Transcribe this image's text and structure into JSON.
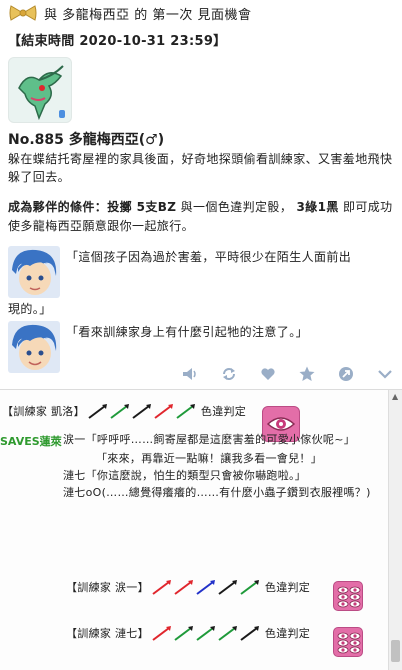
{
  "post": {
    "title": "與 多龍梅西亞 的 第一次 見面機會",
    "end_time": "【結束時間 2020-10-31 23:59】",
    "pokemon_name": "No.885 多龍梅西亞(♂)",
    "description": "躲在蝶結托寄屋裡的家具後面，好奇地探頭偷看訓練家、又害羞地飛快躲了回去。",
    "condition_prefix": "成為夥伴的條件：投擲 ",
    "condition_bz": "5支BZ",
    "condition_mid": " 與一個色違判定骰， ",
    "condition_result": "3綠1黑",
    "condition_suffix": " 即可成功使多龍梅西亞願意跟你一起旅行。",
    "dialog1": "「這個孩子因為過於害羞，平時很少在陌生人面前出",
    "dialog1_cont": "現的。」",
    "dialog2": "「看來訓練家身上有什麼引起牠的注意了。」"
  },
  "toolbar": {
    "icons": [
      "volume-icon",
      "repost-icon",
      "heart-icon",
      "star-icon",
      "share-icon",
      "chevron-down-icon"
    ]
  },
  "rolls": {
    "roll1_label": "【訓練家 凱洛】",
    "roll1_verdict": "色違判定",
    "roll2_label": "【訓練家 涙一】",
    "roll2_verdict": "色違判定",
    "roll3_label": "【訓練家 漣七】",
    "roll3_verdict": "色違判定"
  },
  "comment": {
    "user": "SAVES蓮萊",
    "line1": "涙一「呼呼呼……飼寄屋都是這麼害羞的可愛小傢伙呢~」",
    "line2": "「來來，再靠近一點嘛！讓我多看一會兒！」",
    "line3": "漣七「你這麼說，怕生的類型只會被你嚇跑啦。」",
    "line4": "漣七oO(……總覺得癢癢的……有什麼小蟲子鑽到衣服裡嗎？)"
  },
  "colors": {
    "green_user": "#2f9a2f",
    "die_pink": "#e36ea8",
    "stick_red": "#e0262d",
    "stick_green": "#1f9a3a",
    "stick_black": "#1a1a1a",
    "stick_blue": "#2231c9"
  }
}
